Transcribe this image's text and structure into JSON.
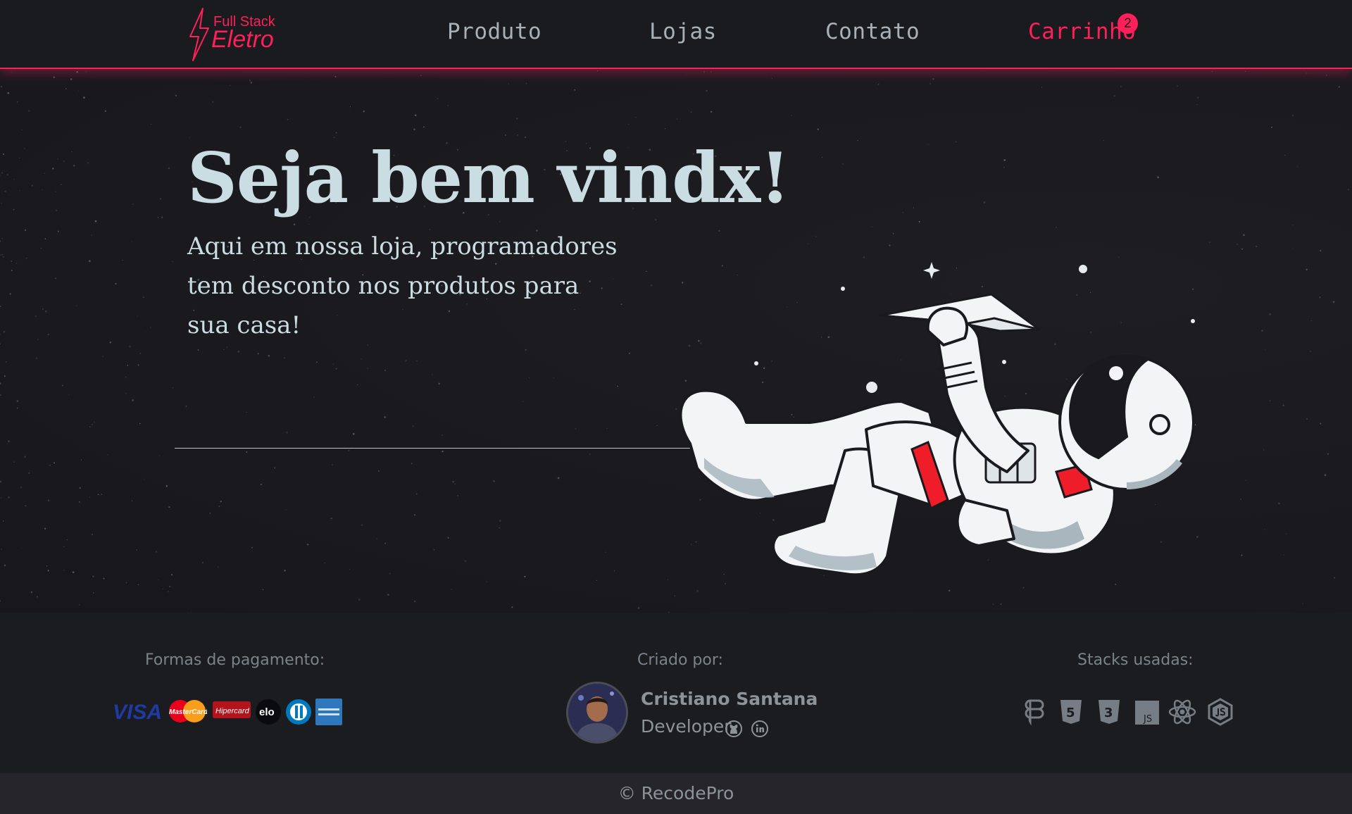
{
  "header": {
    "logo_top": "Full Stack",
    "logo_main": "Eletro",
    "nav": {
      "produto": "Produto",
      "lojas": "Lojas",
      "contato": "Contato",
      "carrinho": "Carrinho"
    },
    "cart_count": "2"
  },
  "hero": {
    "title": "Seja bem vindx!",
    "subtitle": "Aqui em nossa loja, programadores tem desconto nos produtos para sua casa!",
    "illustration": "astronaut-with-paper-plane"
  },
  "footer": {
    "payment_heading": "Formas de pagamento:",
    "payment_methods": [
      "visa",
      "mastercard",
      "hipercard",
      "elo",
      "diners",
      "american-express"
    ],
    "payment_labels": {
      "visa": "VISA",
      "mastercard": "MasterCard",
      "hipercard": "Hipercard",
      "elo": "elo"
    },
    "creator_heading": "Criado por:",
    "creator_name": "Cristiano Santana",
    "creator_role": "Developer",
    "creator_links": [
      "github-icon",
      "linkedin-icon"
    ],
    "stacks_heading": "Stacks usadas:",
    "stacks": [
      "figma-icon",
      "html5-icon",
      "css3-icon",
      "javascript-icon",
      "react-icon",
      "nodejs-icon"
    ],
    "stack_labels": {
      "html5": "5",
      "css3": "3",
      "javascript": "JS"
    }
  },
  "copyright": "© RecodePro",
  "colors": {
    "accent": "#ff1f5a",
    "background": "#1b1b1f",
    "title_text": "#c9dde2",
    "muted_text": "#8c9399"
  }
}
